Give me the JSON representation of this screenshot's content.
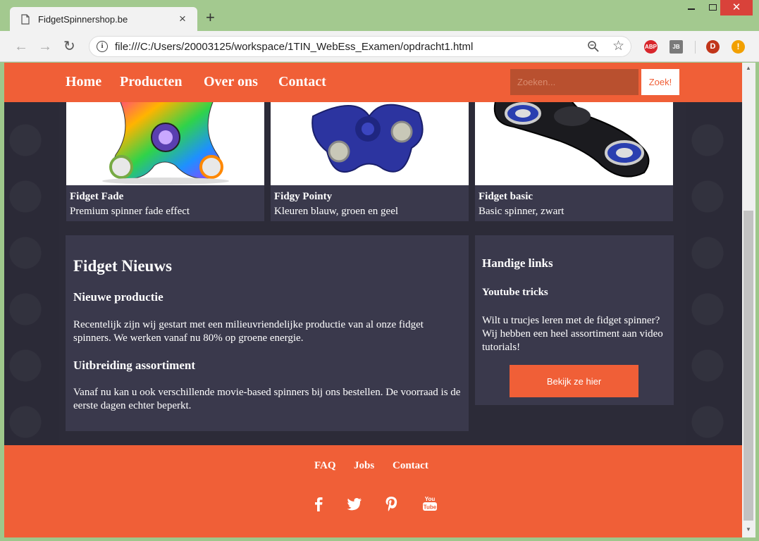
{
  "browser": {
    "tab_title": "FidgetSpinnershop.be",
    "tab_close": "×",
    "new_tab": "+",
    "url": "file:///C:/Users/20003125/workspace/1TIN_WebEss_Examen/opdracht1.html",
    "extensions": {
      "abp": "ABP",
      "jb": "JB",
      "avatar": "D",
      "alert": "!"
    }
  },
  "header": {
    "nav": [
      "Home",
      "Producten",
      "Over ons",
      "Contact"
    ],
    "search_placeholder": "Zoeken...",
    "search_button": "Zoek!"
  },
  "products": [
    {
      "name": "Fidget Fade",
      "description": "Premium spinner fade effect",
      "icon": "rainbow-spinner-image"
    },
    {
      "name": "Fidgy Pointy",
      "description": "Kleuren blauw, groen en geel",
      "icon": "blue-spinner-image"
    },
    {
      "name": "Fidget basic",
      "description": "Basic spinner, zwart",
      "icon": "black-spinner-image"
    }
  ],
  "news": {
    "title": "Fidget Nieuws",
    "items": [
      {
        "heading": "Nieuwe productie",
        "text": "Recentelijk zijn wij gestart met een milieuvriendelijke productie van al onze fidget spinners. We werken vanaf nu 80% op groene energie."
      },
      {
        "heading": "Uitbreiding assortiment",
        "text": "Vanaf nu kan u ook verschillende movie-based spinners bij ons bestellen. De voorraad is de eerste dagen echter beperkt."
      }
    ]
  },
  "links": {
    "title": "Handige links",
    "subtitle": "Youtube tricks",
    "text": "Wilt u trucjes leren met de fidget spinner? Wij hebben een heel assortiment aan video tutorials!",
    "button": "Bekijk ze hier"
  },
  "footer": {
    "links": [
      "FAQ",
      "Jobs",
      "Contact"
    ],
    "social": [
      "facebook-icon",
      "twitter-icon",
      "pinterest-icon",
      "youtube-icon"
    ],
    "youtube_label": "You Tube"
  },
  "colors": {
    "accent": "#f05f37",
    "panel": "#3a394c",
    "background": "#2b2a37"
  }
}
